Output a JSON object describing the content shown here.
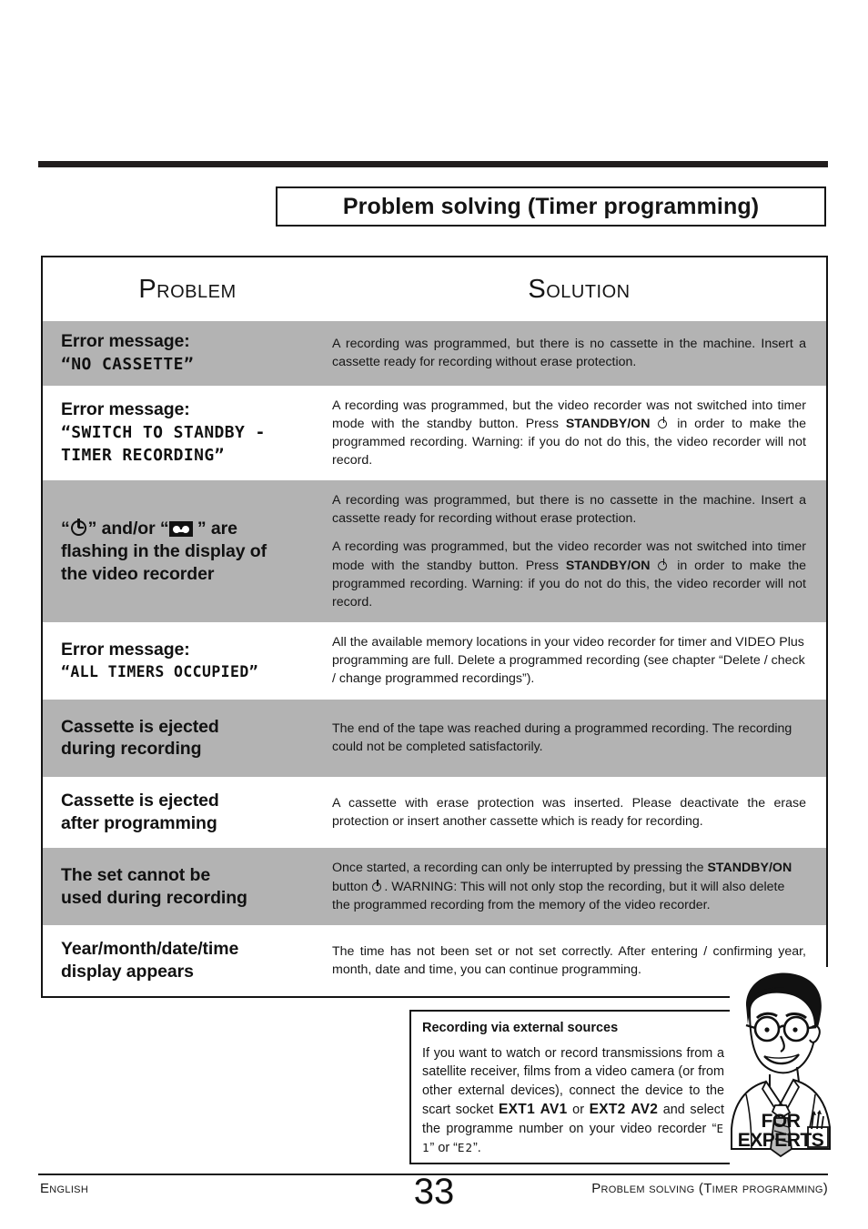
{
  "page": {
    "chapter_title": "Problem solving (Timer programming)",
    "number": "33",
    "footer_left": "English",
    "footer_right": "Problem solving (Timer programming)"
  },
  "table": {
    "header": {
      "problem": "Problem",
      "solution": "Solution"
    },
    "rows": [
      {
        "shaded": true,
        "problem_lines": [
          "Error message:"
        ],
        "problem_mono": [
          "“NO CASSETTE”"
        ],
        "solutions": [
          "A recording was programmed, but there is no cassette in the machine. Insert a cassette ready for recording without erase protection."
        ]
      },
      {
        "shaded": false,
        "problem_lines": [
          "Error message:"
        ],
        "problem_mono": [
          "“SWITCH TO STANDBY -",
          "TIMER RECORDING”"
        ],
        "solutions": [
          "A recording was programmed, but the video recorder was not switched into timer mode with the standby button. Press STANDBY/ON ⏻ in order to make the programmed recording. Warning: if you do not do this, the video recorder will not record."
        ]
      },
      {
        "shaded": true,
        "problem_lines": [
          "“⏻” and/or “▣” are",
          "flashing in the display of",
          "the video recorder"
        ],
        "problem_mono": [],
        "solutions": [
          "A recording was programmed, but there is no cassette in the machine. Insert a cassette ready for recording without erase protection.",
          "A recording was programmed, but the video recorder was not switched into timer mode with the standby button. Press STANDBY/ON ⏻ in order to make the programmed recording. Warning: if you do not do this, the video recorder will not record."
        ]
      },
      {
        "shaded": false,
        "problem_lines": [
          "Error message:"
        ],
        "problem_mono": [
          "“ALL TIMERS OCCUPIED”"
        ],
        "solutions": [
          "All the available memory locations in your video recorder for timer and VIDEO Plus programming are full. Delete a programmed recording (see chapter “Delete / check / change programmed recordings”)."
        ]
      },
      {
        "shaded": true,
        "problem_lines": [
          "Cassette is ejected",
          "during recording"
        ],
        "problem_mono": [],
        "solutions": [
          "The end of the tape was reached during a programmed recording. The recording could not be completed satisfactorily."
        ]
      },
      {
        "shaded": false,
        "problem_lines": [
          "Cassette is ejected",
          "after programming"
        ],
        "problem_mono": [],
        "solutions": [
          "A cassette with erase protection was inserted. Please deactivate the erase protection or insert another cassette which is ready for recording."
        ]
      },
      {
        "shaded": true,
        "problem_lines": [
          "The set cannot be",
          "used during recording"
        ],
        "problem_mono": [],
        "solutions": [
          "Once started, a recording can only be interrupted by pressing the STANDBY/ON button ⏻. WARNING: This will not only stop the recording, but it will also delete the programmed recording from the memory of the video recorder."
        ]
      },
      {
        "shaded": false,
        "problem_lines": [
          "Year/month/date/time",
          "display appears"
        ],
        "problem_mono": [],
        "solutions": [
          "The time has not been set or not set correctly. After entering / confirming year, month, date and time, you can continue programming."
        ]
      }
    ]
  },
  "experts": {
    "title": "Recording via external sources",
    "body_1": "If you want to watch or record transmissions from a satellite receiver, films from a video camera (or from other external devices), connect the device to the scart socket ",
    "socket_1": "EXT1 AV1",
    "body_2": " or ",
    "socket_2": "EXT2 AV2",
    "body_3": " and select the programme number on your video recorder “",
    "code_1": "E 1",
    "body_4": "” or “",
    "code_2": "E2",
    "body_5": "”.",
    "label_line1": "FOR",
    "label_line2": "EXPERTS"
  },
  "colors": {
    "shaded_row": "#b3b3b3",
    "ink": "#111111",
    "page_background": "#ffffff"
  }
}
